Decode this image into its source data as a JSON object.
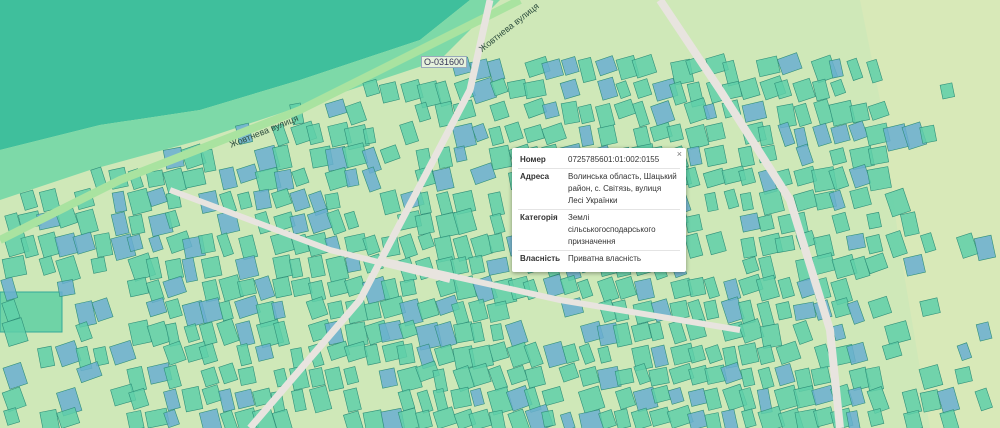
{
  "map": {
    "street_labels": [
      "Жовтнева вулиця",
      "Жовтнева вулиця"
    ],
    "road_badge": "О-031600"
  },
  "popup": {
    "close": "×",
    "rows": [
      {
        "key": "Номер",
        "value": "0725785601:01:002:0155"
      },
      {
        "key": "Адреса",
        "value": "Волинська область, Шацький район, с. Світязь, вулиця Лесі Українки"
      },
      {
        "key": "Категорія",
        "value": "Землі сільськогосподарського призначення"
      },
      {
        "key": "Власність",
        "value": "Приватна власність"
      }
    ]
  },
  "colors": {
    "water": "#3fbf9c",
    "parcel": "#5fcfa8",
    "parcel_blue": "#6aaed0",
    "road": "#e8e4df",
    "land": "#cfe8b8"
  }
}
